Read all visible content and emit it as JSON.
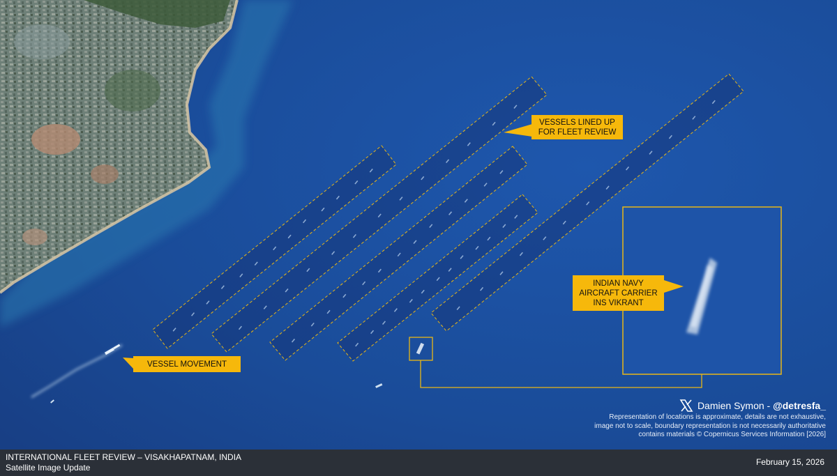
{
  "map": {
    "title": "INTERNATIONAL FLEET REVIEW – VISAKHAPATNAM, INDIA",
    "subtitle": "Satellite Image Update",
    "date": "February 15, 2026"
  },
  "annotations": {
    "vessels_lined_up": [
      "VESSELS LINED UP",
      "FOR FLEET REVIEW"
    ],
    "aircraft_carrier": [
      "INDIAN NAVY",
      "AIRCRAFT CARRIER",
      "INS VIKRANT"
    ],
    "vessel_movement": "VESSEL MOVEMENT"
  },
  "attribution": {
    "author": "Damien Symon - ",
    "handle": "@detresfa_",
    "icon": "x-logo-icon",
    "disclaimer": [
      "Representation of locations is approximate, details are not exhaustive,",
      "image not to scale, boundary representation is not necessarily authoritative",
      "contains materials © Copernicus Services Information  [2026]"
    ]
  },
  "colors": {
    "sea": "#1b4c99",
    "accent": "#f6b80b",
    "footer": "#2b3038"
  }
}
